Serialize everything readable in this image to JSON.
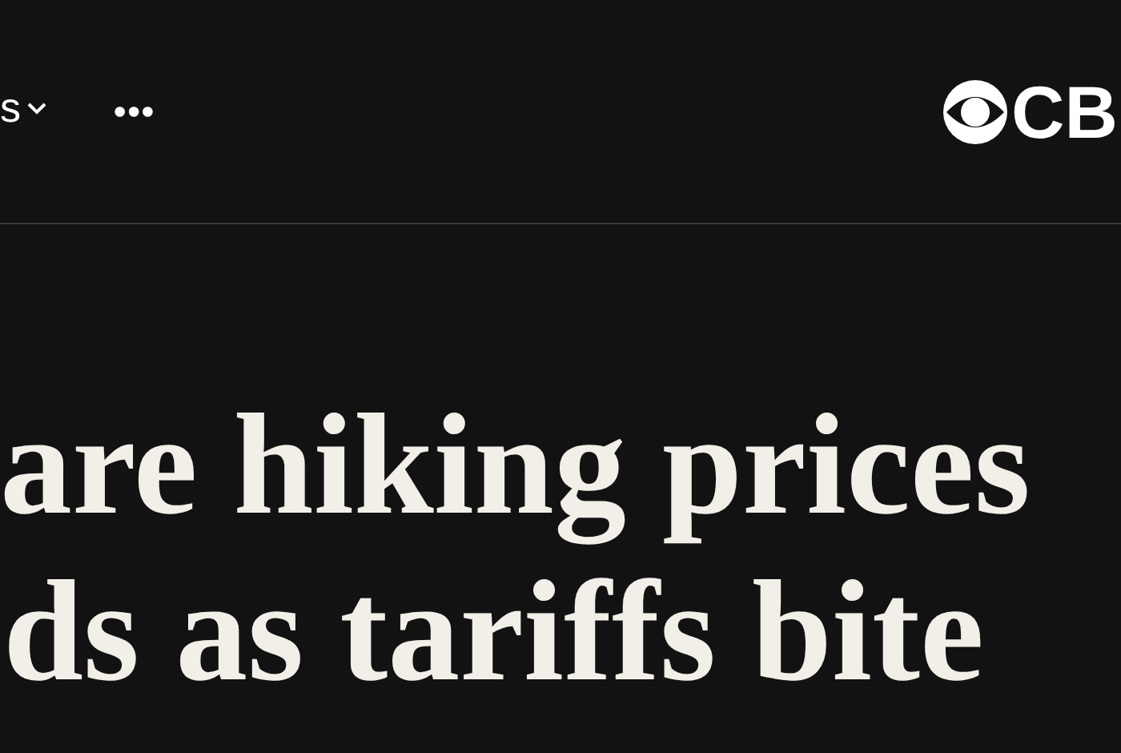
{
  "nav": {
    "menu_label": "s",
    "more_label": "•••"
  },
  "logo": {
    "text": "CB"
  },
  "headline": {
    "lines": [
      "are hiking prices",
      "ds as tariffs bite"
    ]
  }
}
